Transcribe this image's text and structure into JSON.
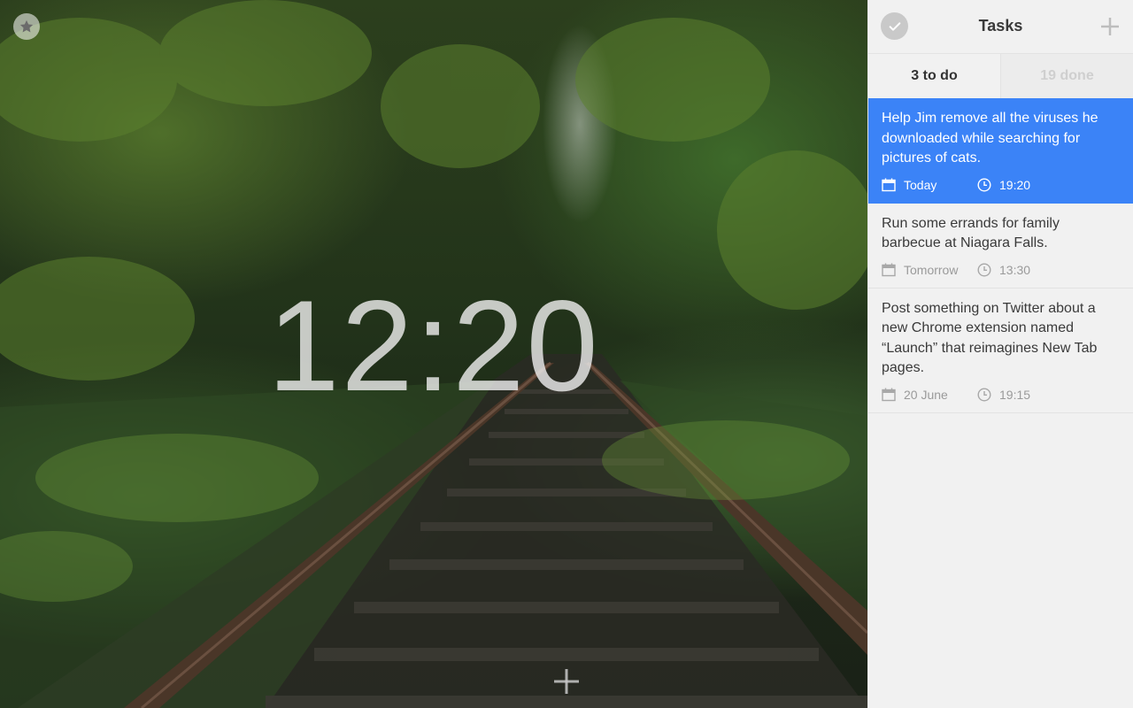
{
  "clock": {
    "time": "12:20"
  },
  "panel": {
    "title": "Tasks",
    "tabs": [
      {
        "label": "3 to do",
        "active": true
      },
      {
        "label": "19 done",
        "active": false
      }
    ],
    "tasks": [
      {
        "text": "Help Jim remove all the viruses he downloaded while searching for pictures of cats.",
        "date": "Today",
        "time": "19:20",
        "selected": true
      },
      {
        "text": "Run some errands for family barbecue at Niagara Falls.",
        "date": "Tomorrow",
        "time": "13:30",
        "selected": false
      },
      {
        "text": "Post something on Twitter about a new Chrome extension named “Launch” that reimagines New Tab pages.",
        "date": "20 June",
        "time": "19:15",
        "selected": false
      }
    ]
  },
  "colors": {
    "accent": "#3b83f7",
    "panel_bg": "#f1f1f1",
    "text": "#3a3a3a",
    "muted": "#9a9a9a"
  },
  "icons": {
    "favorite": "star-icon",
    "complete_all": "checkmark-icon",
    "new_task": "plus-icon",
    "date": "calendar-icon",
    "time": "clock-icon",
    "add_widget": "plus-icon"
  }
}
